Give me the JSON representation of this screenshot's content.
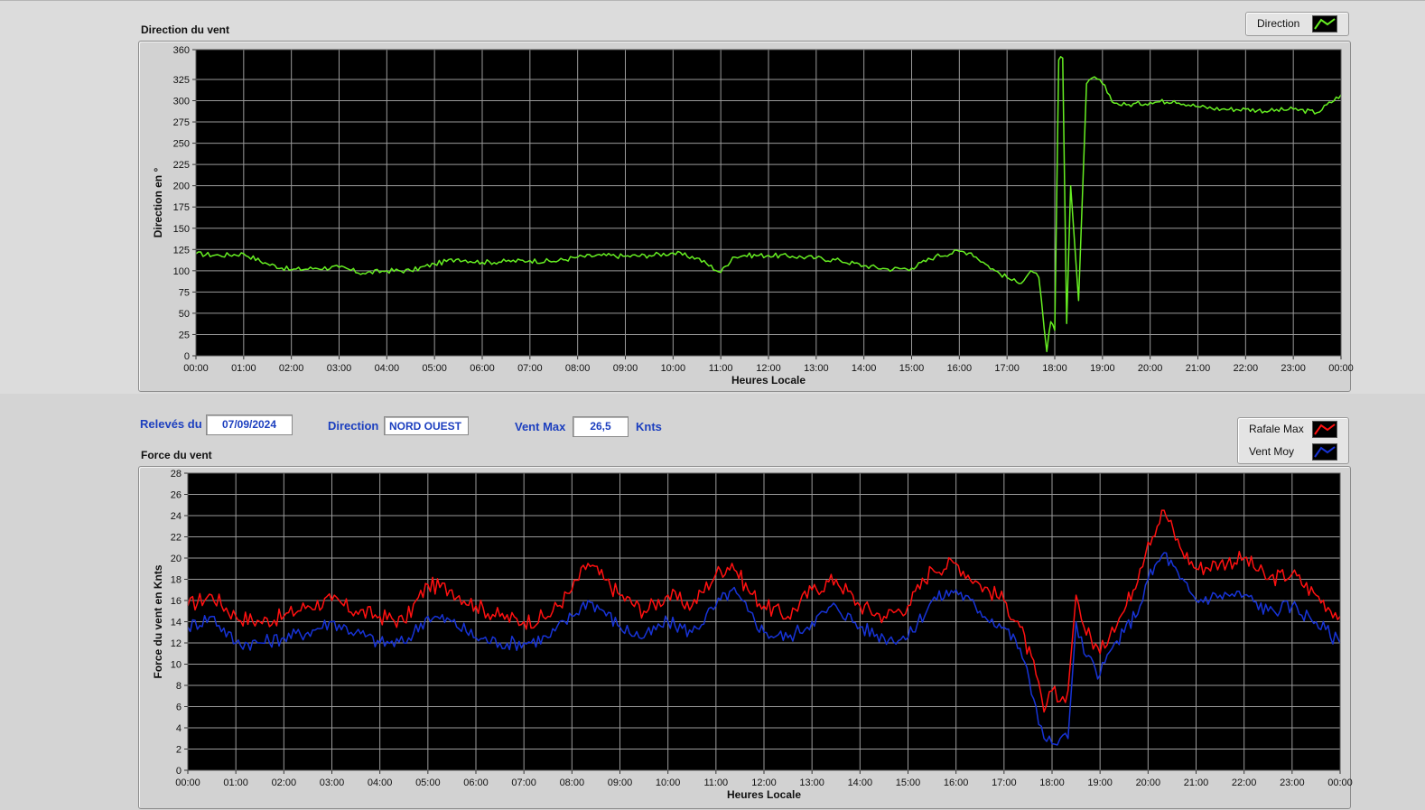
{
  "info": {
    "releves_label": "Relevés du",
    "releves_date": "07/09/2024",
    "direction_label": "Direction",
    "direction_value": "NORD OUEST",
    "ventmax_label": "Vent Max",
    "ventmax_value": "26,5",
    "ventmax_unit": "Knts"
  },
  "legend_top": {
    "direction": "Direction"
  },
  "legend_bottom": {
    "rafale": "Rafale Max",
    "vent": "Vent Moy"
  },
  "colors": {
    "direction": "#66ee22",
    "rafale": "#ff1010",
    "vent": "#1733d6",
    "plot_bg": "#000000",
    "grid": "#9a9a9a"
  },
  "chart_data": [
    {
      "type": "line",
      "title": "Direction du vent",
      "xlabel": "Heures Locale",
      "ylabel": "Direction en °",
      "ylim": [
        0,
        360
      ],
      "yticks": [
        0,
        25,
        50,
        75,
        100,
        125,
        150,
        175,
        200,
        225,
        250,
        275,
        300,
        325,
        360
      ],
      "xlim": [
        "00:00",
        "24:00"
      ],
      "xticks": [
        "00:00",
        "01:00",
        "02:00",
        "03:00",
        "04:00",
        "05:00",
        "06:00",
        "07:00",
        "08:00",
        "09:00",
        "10:00",
        "11:00",
        "12:00",
        "13:00",
        "14:00",
        "15:00",
        "16:00",
        "17:00",
        "18:00",
        "19:00",
        "20:00",
        "21:00",
        "22:00",
        "23:00",
        "00:00"
      ],
      "grid": true,
      "legend": "top-right",
      "series": [
        {
          "name": "Direction",
          "x": [
            "00:00",
            "00:30",
            "01:00",
            "01:30",
            "02:00",
            "02:30",
            "03:00",
            "03:30",
            "04:00",
            "04:30",
            "05:00",
            "05:30",
            "06:00",
            "06:30",
            "07:00",
            "07:30",
            "08:00",
            "08:30",
            "09:00",
            "09:30",
            "10:00",
            "10:30",
            "11:00",
            "11:15",
            "11:30",
            "12:00",
            "12:30",
            "13:00",
            "13:30",
            "14:00",
            "14:30",
            "15:00",
            "15:30",
            "16:00",
            "16:15",
            "16:30",
            "16:45",
            "17:00",
            "17:15",
            "17:30",
            "17:40",
            "17:50",
            "17:55",
            "18:00",
            "18:05",
            "18:10",
            "18:15",
            "18:20",
            "18:30",
            "18:40",
            "18:50",
            "19:00",
            "19:15",
            "19:30",
            "20:00",
            "20:30",
            "21:00",
            "21:30",
            "22:00",
            "22:30",
            "23:00",
            "23:30",
            "24:00"
          ],
          "values": [
            120,
            118,
            120,
            108,
            101,
            103,
            104,
            97,
            100,
            100,
            108,
            114,
            110,
            111,
            112,
            111,
            116,
            118,
            117,
            118,
            121,
            115,
            98,
            116,
            118,
            118,
            117,
            115,
            112,
            106,
            102,
            103,
            117,
            123,
            121,
            110,
            100,
            92,
            85,
            100,
            92,
            5,
            40,
            30,
            348,
            350,
            38,
            200,
            65,
            320,
            328,
            320,
            297,
            295,
            298,
            300,
            293,
            290,
            290,
            288,
            290,
            286,
            307
          ]
        }
      ]
    },
    {
      "type": "line",
      "title": "Force du vent",
      "xlabel": "Heures Locale",
      "ylabel": "Force du vent en Knts",
      "ylim": [
        0,
        28
      ],
      "yticks": [
        0,
        2,
        4,
        6,
        8,
        10,
        12,
        14,
        16,
        18,
        20,
        22,
        24,
        26,
        28
      ],
      "xlim": [
        "00:00",
        "24:00"
      ],
      "xticks": [
        "00:00",
        "01:00",
        "02:00",
        "03:00",
        "04:00",
        "05:00",
        "06:00",
        "07:00",
        "08:00",
        "09:00",
        "10:00",
        "11:00",
        "12:00",
        "13:00",
        "14:00",
        "15:00",
        "16:00",
        "17:00",
        "18:00",
        "19:00",
        "20:00",
        "21:00",
        "22:00",
        "23:00",
        "00:00"
      ],
      "grid": true,
      "legend": "top-right",
      "series": [
        {
          "name": "Rafale Max",
          "x": [
            "00:00",
            "00:30",
            "01:00",
            "01:30",
            "02:00",
            "02:30",
            "03:00",
            "03:30",
            "04:00",
            "04:30",
            "05:00",
            "05:30",
            "06:00",
            "06:30",
            "07:00",
            "07:30",
            "08:00",
            "08:20",
            "08:40",
            "09:00",
            "09:30",
            "10:00",
            "10:30",
            "11:00",
            "11:20",
            "11:40",
            "12:00",
            "12:30",
            "13:00",
            "13:30",
            "14:00",
            "14:30",
            "15:00",
            "15:30",
            "16:00",
            "16:30",
            "17:00",
            "17:20",
            "17:40",
            "17:50",
            "18:00",
            "18:10",
            "18:20",
            "18:30",
            "18:40",
            "19:00",
            "19:15",
            "19:30",
            "19:50",
            "20:00",
            "20:20",
            "20:40",
            "21:00",
            "21:30",
            "22:00",
            "22:30",
            "23:00",
            "23:30",
            "24:00"
          ],
          "values": [
            15.5,
            16.5,
            14.5,
            14.0,
            14.5,
            15.5,
            16.0,
            15.0,
            14.5,
            14.0,
            17.5,
            17.0,
            15.5,
            14.5,
            14.0,
            14.5,
            17.0,
            19.5,
            18.0,
            16.5,
            15.0,
            16.5,
            15.5,
            18.5,
            19.5,
            17.0,
            15.5,
            14.5,
            17.0,
            18.0,
            15.5,
            14.5,
            15.5,
            19.0,
            19.5,
            17.5,
            16.0,
            13.5,
            9.0,
            5.5,
            7.5,
            6.5,
            7.5,
            16.5,
            13.5,
            11.0,
            13.5,
            15.0,
            19.0,
            21.5,
            24.5,
            21.0,
            19.0,
            19.5,
            20.0,
            18.0,
            18.5,
            16.5,
            14.5
          ]
        },
        {
          "name": "Vent Moy",
          "x": [
            "00:00",
            "00:30",
            "01:00",
            "01:30",
            "02:00",
            "02:30",
            "03:00",
            "03:30",
            "04:00",
            "04:30",
            "05:00",
            "05:30",
            "06:00",
            "06:30",
            "07:00",
            "07:30",
            "08:00",
            "08:20",
            "08:40",
            "09:00",
            "09:30",
            "10:00",
            "10:30",
            "11:00",
            "11:20",
            "11:40",
            "12:00",
            "12:30",
            "13:00",
            "13:30",
            "14:00",
            "14:30",
            "15:00",
            "15:30",
            "16:00",
            "16:30",
            "17:00",
            "17:20",
            "17:40",
            "17:50",
            "18:00",
            "18:10",
            "18:20",
            "18:30",
            "18:40",
            "19:00",
            "19:15",
            "19:30",
            "19:50",
            "20:00",
            "20:20",
            "20:40",
            "21:00",
            "21:30",
            "22:00",
            "22:30",
            "23:00",
            "23:30",
            "24:00"
          ],
          "values": [
            13.5,
            14.5,
            12.0,
            12.0,
            12.5,
            13.0,
            14.0,
            13.0,
            12.0,
            12.0,
            14.5,
            14.0,
            12.5,
            12.0,
            12.0,
            12.5,
            14.5,
            16.0,
            15.0,
            13.5,
            12.5,
            14.0,
            13.0,
            15.5,
            17.0,
            15.0,
            13.0,
            12.5,
            14.0,
            15.5,
            13.5,
            12.5,
            12.5,
            16.0,
            17.0,
            15.0,
            13.5,
            11.5,
            6.0,
            3.0,
            2.5,
            3.0,
            3.0,
            14.0,
            11.0,
            9.0,
            11.5,
            13.0,
            15.5,
            18.0,
            20.5,
            18.0,
            16.0,
            16.5,
            16.5,
            15.0,
            15.5,
            14.0,
            12.0
          ]
        }
      ]
    }
  ]
}
